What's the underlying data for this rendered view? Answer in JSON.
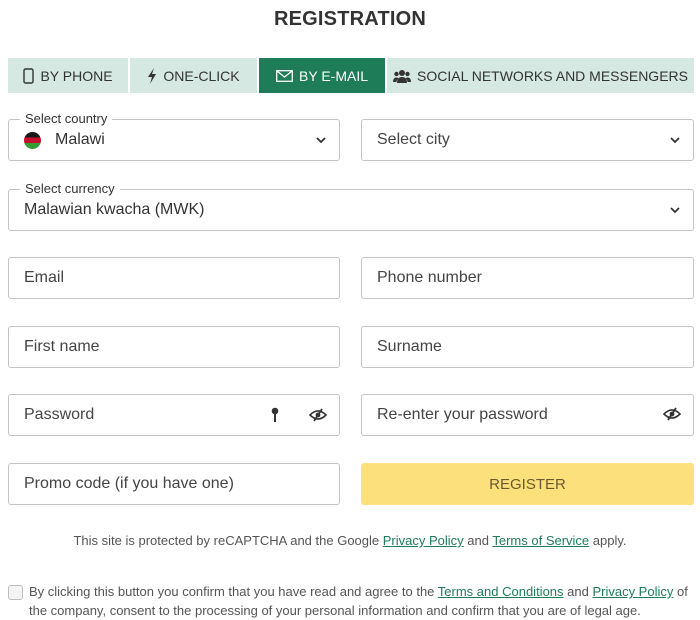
{
  "header": {
    "title": "REGISTRATION"
  },
  "tabs": [
    {
      "label": "BY PHONE",
      "icon": "phone-icon",
      "active": false
    },
    {
      "label": "ONE-CLICK",
      "icon": "lightning-icon",
      "active": false
    },
    {
      "label": "BY E-MAIL",
      "icon": "envelope-icon",
      "active": true
    },
    {
      "label": "SOCIAL NETWORKS AND MESSENGERS",
      "icon": "users-icon",
      "active": false
    }
  ],
  "form": {
    "country": {
      "legend": "Select country",
      "value": "Malawi",
      "flag": "malawi-flag"
    },
    "city": {
      "placeholder": "Select city"
    },
    "currency": {
      "legend": "Select currency",
      "value": "Malawian kwacha (MWK)"
    },
    "email": {
      "placeholder": "Email"
    },
    "phone": {
      "placeholder": "Phone number"
    },
    "first_name": {
      "placeholder": "First name"
    },
    "surname": {
      "placeholder": "Surname"
    },
    "password": {
      "placeholder": "Password"
    },
    "repassword": {
      "placeholder": "Re-enter your password"
    },
    "promo": {
      "placeholder": "Promo code (if you have one)"
    },
    "register_label": "REGISTER"
  },
  "recaptcha": {
    "prefix": "This site is protected by reCAPTCHA and the Google ",
    "privacy_link": "Privacy Policy",
    "middle": " and ",
    "terms_link": "Terms of Service",
    "suffix": " apply."
  },
  "consent": {
    "prefix": "By clicking this button you confirm that you have read and agree to the ",
    "terms_link": "Terms and Conditions",
    "middle": " and ",
    "privacy_link": "Privacy Policy",
    "suffix": " of the company, consent to the processing of your personal information and confirm that you are of legal age.",
    "checked": false
  },
  "colors": {
    "accent": "#1f7c59",
    "tab_bg": "#d6e8e2",
    "register_bg": "#fbe07c"
  }
}
